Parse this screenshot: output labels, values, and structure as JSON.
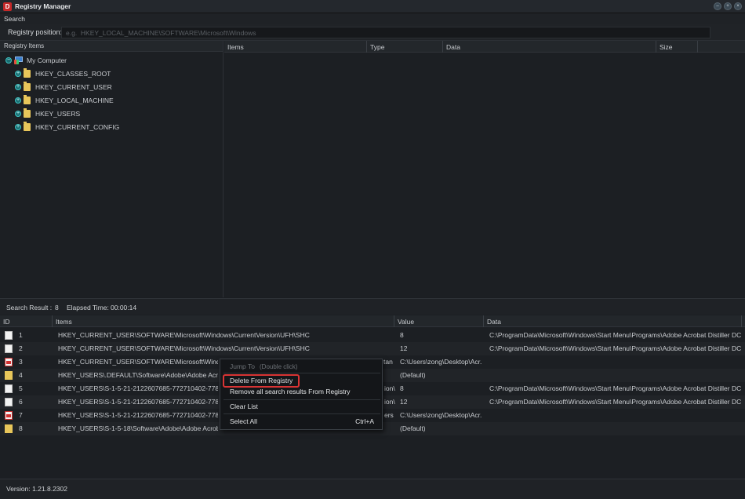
{
  "window": {
    "title": "Registry Manager",
    "logo_letter": "D"
  },
  "menu": {
    "search_label": "Search"
  },
  "registry_position": {
    "label": "Registry position:",
    "value": "",
    "placeholder": "e.g.  HKEY_LOCAL_MACHINE\\SOFTWARE\\Microsoft\\Windows"
  },
  "tree": {
    "header": "Registry Items",
    "root": "My Computer",
    "nodes": [
      "HKEY_CLASSES_ROOT",
      "HKEY_CURRENT_USER",
      "HKEY_LOCAL_MACHINE",
      "HKEY_USERS",
      "HKEY_CURRENT_CONFIG"
    ]
  },
  "items_grid": {
    "columns": [
      "Items",
      "Type",
      "Data",
      "Size"
    ]
  },
  "status": {
    "result_label": "Search Result :",
    "result_count": "8",
    "elapsed_label": "Elapsed Time:",
    "elapsed_value": "00:00:14"
  },
  "results": {
    "columns": [
      "ID",
      "Items",
      "Value",
      "Data"
    ],
    "rows": [
      {
        "id": "1",
        "icon": "document-icon",
        "item": "HKEY_CURRENT_USER\\SOFTWARE\\Microsoft\\Windows\\CurrentVersion\\UFH\\SHC",
        "value": "8",
        "data": "C:\\ProgramData\\Microsoft\\Windows\\Start Menu\\Programs\\Adobe Acrobat Distiller DC"
      },
      {
        "id": "2",
        "icon": "document-icon",
        "item": "HKEY_CURRENT_USER\\SOFTWARE\\Microsoft\\Windows\\CurrentVersion\\UFH\\SHC",
        "value": "12",
        "data": "C:\\ProgramData\\Microsoft\\Windows\\Start Menu\\Programs\\Adobe Acrobat Distiller DC"
      },
      {
        "id": "3",
        "icon": "pdf-icon",
        "item": "HKEY_CURRENT_USER\\SOFTWARE\\Microsoft\\Window",
        "value_fragment": "tan",
        "value": "C:\\Users\\zong\\Desktop\\Acr.",
        "data": ""
      },
      {
        "id": "4",
        "icon": "folder-icon",
        "item": "HKEY_USERS\\.DEFAULT\\Software\\Adobe\\Adobe Acro",
        "value": "(Default)",
        "data": ""
      },
      {
        "id": "5",
        "icon": "document-icon",
        "item": "HKEY_USERS\\S-1-5-21-2122607685-772710402-778",
        "value_fragment": "ion\\",
        "value": "8",
        "data": "C:\\ProgramData\\Microsoft\\Windows\\Start Menu\\Programs\\Adobe Acrobat Distiller DC"
      },
      {
        "id": "6",
        "icon": "document-icon",
        "item": "HKEY_USERS\\S-1-5-21-2122607685-772710402-778",
        "value_fragment": "ion\\",
        "value": "12",
        "data": "C:\\ProgramData\\Microsoft\\Windows\\Start Menu\\Programs\\Adobe Acrobat Distiller DC"
      },
      {
        "id": "7",
        "icon": "pdf-icon",
        "item": "HKEY_USERS\\S-1-5-21-2122607685-772710402-778",
        "value_fragment": "ers",
        "value": "C:\\Users\\zong\\Desktop\\Acr.",
        "data": ""
      },
      {
        "id": "8",
        "icon": "folder-icon",
        "item": "HKEY_USERS\\S-1-5-18\\Software\\Adobe\\Adobe Acrob",
        "value": "(Default)",
        "data": ""
      }
    ]
  },
  "context_menu": {
    "jump_to": "Jump To",
    "jump_hint": "(Double click)",
    "delete": "Delete From Registry",
    "remove_all": "Remove all search results From Registry",
    "clear_list": "Clear List",
    "select_all": "Select All",
    "select_all_shortcut": "Ctrl+A",
    "highlight_color": "#d93434"
  },
  "footer": {
    "version": "Version: 1.21.8.2302"
  },
  "colors": {
    "background": "#1b1e22",
    "panel": "#1c1f23",
    "header": "#23272b"
  }
}
